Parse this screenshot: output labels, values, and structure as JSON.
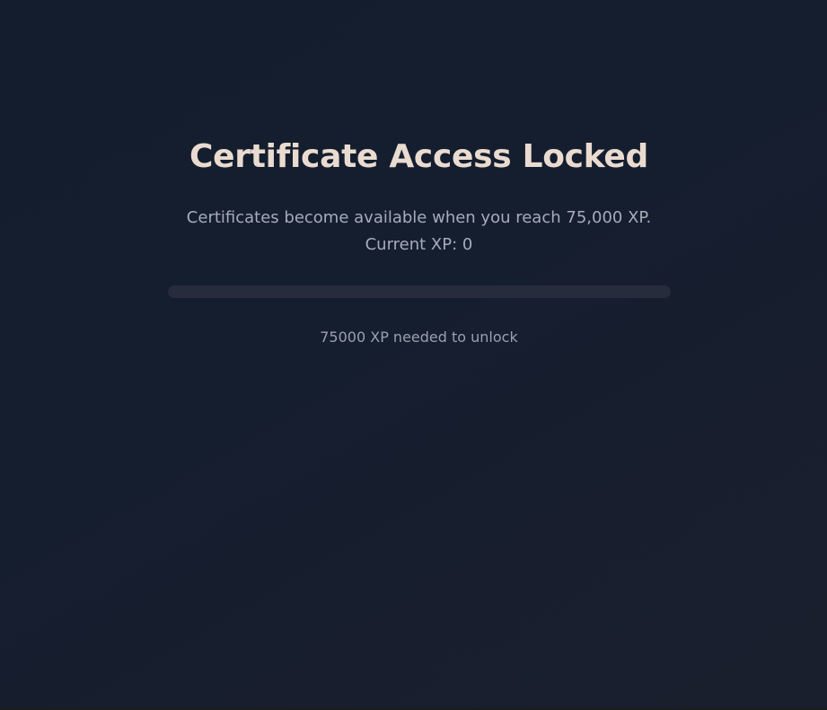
{
  "locked": {
    "title": "Certificate Access Locked",
    "description_line1": "Certificates become available when you reach 75,000 XP.",
    "description_line2": "Current XP: 0",
    "progress_fraction": 0,
    "needed_text": "75000 XP needed to unlock"
  },
  "colors": {
    "background": "#151e2f",
    "title": "#eadbd0",
    "text": "#a6acb8",
    "progress_track": "#262c3c"
  }
}
